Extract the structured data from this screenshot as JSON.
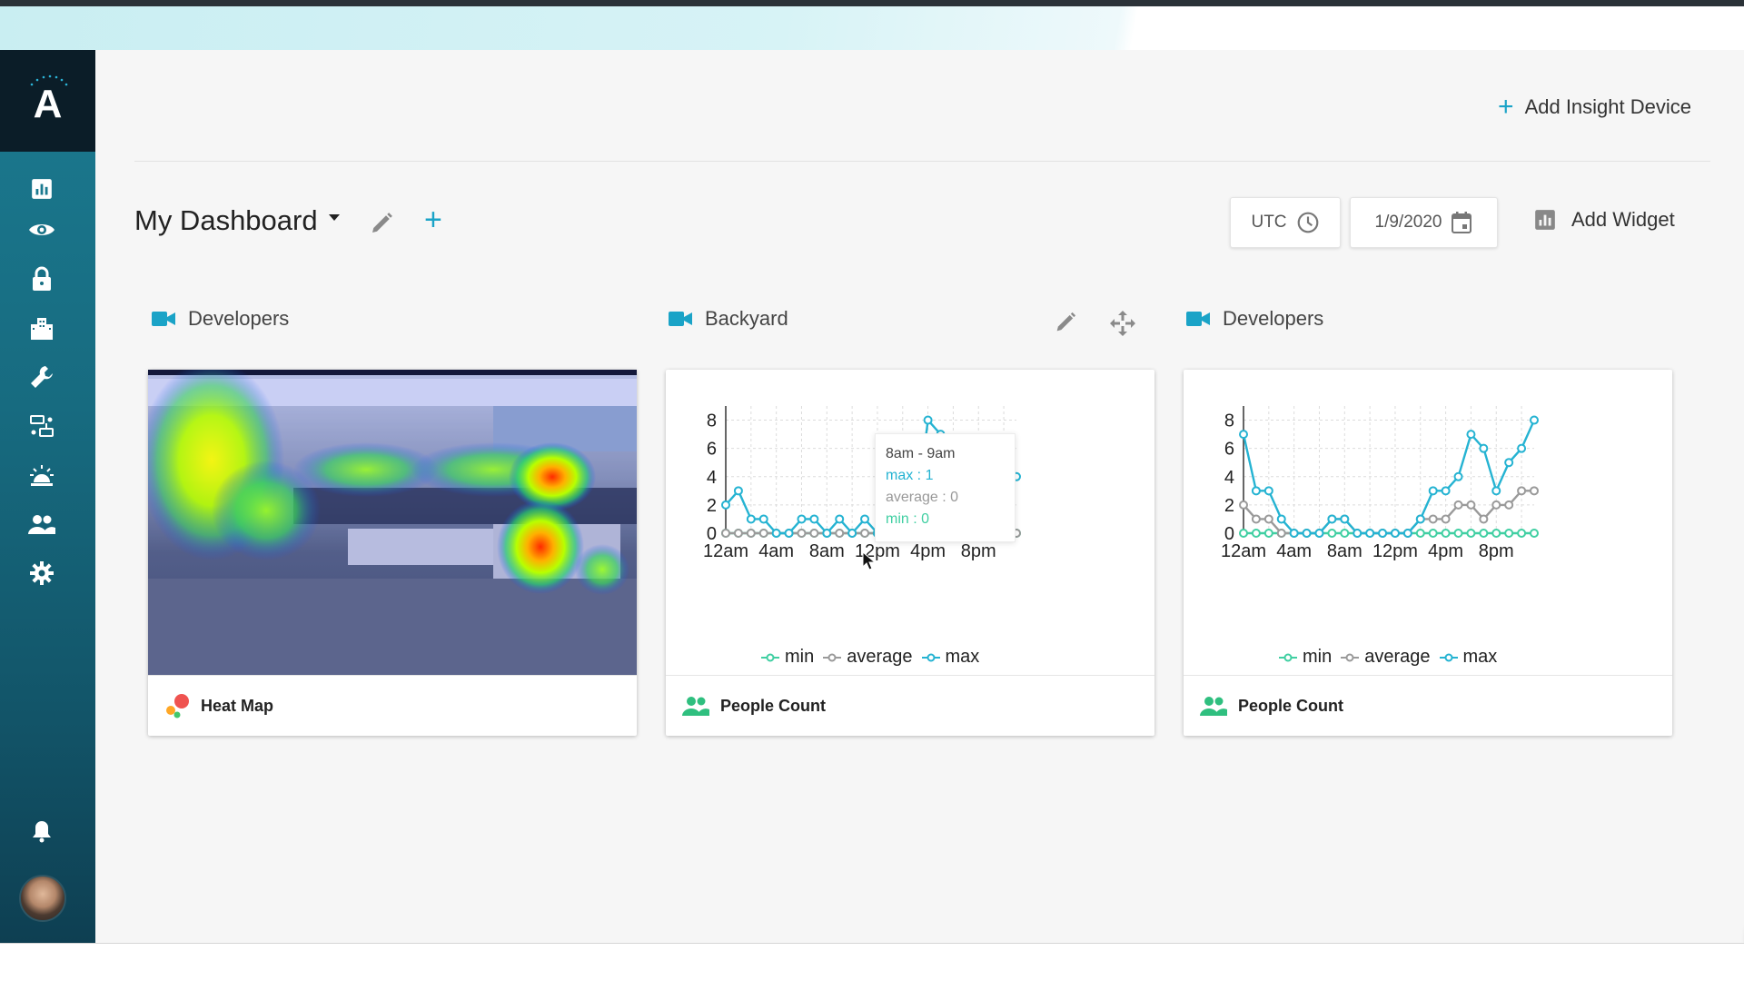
{
  "header": {
    "add_insight_label": "Add Insight Device",
    "dashboard_title": "My Dashboard",
    "timezone": "UTC",
    "date": "1/9/2020",
    "add_widget_label": "Add Widget"
  },
  "sidebar": {
    "logo": "A",
    "items": [
      {
        "icon": "bar-chart-icon"
      },
      {
        "icon": "eye-icon"
      },
      {
        "icon": "lock-icon"
      },
      {
        "icon": "building-icon"
      },
      {
        "icon": "wrench-icon"
      },
      {
        "icon": "rules-icon"
      },
      {
        "icon": "alarm-icon"
      },
      {
        "icon": "users-icon"
      },
      {
        "icon": "gear-icon"
      }
    ],
    "bell_icon": "bell-icon",
    "avatar_icon": "avatar"
  },
  "widgets": [
    {
      "camera": "Developers",
      "footer_label": "Heat Map",
      "footer_icon": "heatmap-icon"
    },
    {
      "camera": "Backyard",
      "footer_label": "People Count",
      "footer_icon": "people-icon"
    },
    {
      "camera": "Developers",
      "footer_label": "People Count",
      "footer_icon": "people-icon"
    }
  ],
  "tooltip": {
    "time": "8am - 9am",
    "max": "max : 1",
    "average": "average : 0",
    "min": "min : 0"
  },
  "legend": {
    "min": "min",
    "average": "average",
    "max": "max"
  },
  "colors": {
    "accent": "#1aa3c7",
    "max_series": "#25b3d2",
    "min_series": "#40cfa2",
    "average_series": "#9a9a9a",
    "people_icon": "#2fbf7f"
  },
  "chart_data": [
    {
      "type": "line",
      "x": [
        "12am",
        "1am",
        "2am",
        "3am",
        "4am",
        "5am",
        "6am",
        "7am",
        "8am",
        "9am",
        "10am",
        "11am",
        "12pm",
        "1pm",
        "2pm",
        "3pm",
        "4pm",
        "5pm",
        "6pm",
        "7pm",
        "8pm",
        "9pm",
        "10pm",
        "11pm"
      ],
      "xticks": [
        "12am",
        "4am",
        "8am",
        "12pm",
        "4pm",
        "8pm"
      ],
      "yticks": [
        "0",
        "2",
        "4",
        "6",
        "8"
      ],
      "ylim": [
        0,
        9
      ],
      "grid": true,
      "legend_placement": "bottom",
      "series": [
        {
          "name": "min",
          "values": [
            0,
            0,
            0,
            0,
            0,
            0,
            0,
            0,
            0,
            0,
            0,
            0,
            0,
            0,
            0,
            0,
            0,
            0,
            0,
            0,
            0,
            0,
            0,
            0
          ]
        },
        {
          "name": "average",
          "values": [
            0,
            0,
            0,
            0,
            0,
            0,
            0,
            0,
            0,
            0,
            0,
            0,
            0,
            0,
            0,
            0,
            0,
            0,
            1,
            1,
            0,
            0,
            0,
            0
          ]
        },
        {
          "name": "max",
          "values": [
            2,
            3,
            1,
            1,
            0,
            0,
            1,
            1,
            0,
            1,
            0,
            1,
            0,
            1,
            1,
            1,
            8,
            7,
            5,
            4,
            3,
            4,
            4,
            4
          ]
        }
      ]
    },
    {
      "type": "line",
      "x": [
        "12am",
        "1am",
        "2am",
        "3am",
        "4am",
        "5am",
        "6am",
        "7am",
        "8am",
        "9am",
        "10am",
        "11am",
        "12pm",
        "1pm",
        "2pm",
        "3pm",
        "4pm",
        "5pm",
        "6pm",
        "7pm",
        "8pm",
        "9pm",
        "10pm",
        "11pm"
      ],
      "xticks": [
        "12am",
        "4am",
        "8am",
        "12pm",
        "4pm",
        "8pm"
      ],
      "yticks": [
        "0",
        "2",
        "4",
        "6",
        "8"
      ],
      "ylim": [
        0,
        9
      ],
      "grid": true,
      "legend_placement": "bottom",
      "series": [
        {
          "name": "min",
          "values": [
            0,
            0,
            0,
            0,
            0,
            0,
            0,
            0,
            0,
            0,
            0,
            0,
            0,
            0,
            0,
            0,
            0,
            0,
            0,
            0,
            0,
            0,
            0,
            0
          ]
        },
        {
          "name": "average",
          "values": [
            2,
            1,
            1,
            0,
            0,
            0,
            0,
            1,
            1,
            0,
            0,
            0,
            0,
            0,
            1,
            1,
            1,
            2,
            2,
            1,
            2,
            2,
            3,
            3
          ]
        },
        {
          "name": "max",
          "values": [
            7,
            3,
            3,
            1,
            0,
            0,
            0,
            1,
            1,
            0,
            0,
            0,
            0,
            0,
            1,
            3,
            3,
            4,
            7,
            6,
            3,
            5,
            6,
            8
          ]
        }
      ]
    }
  ]
}
